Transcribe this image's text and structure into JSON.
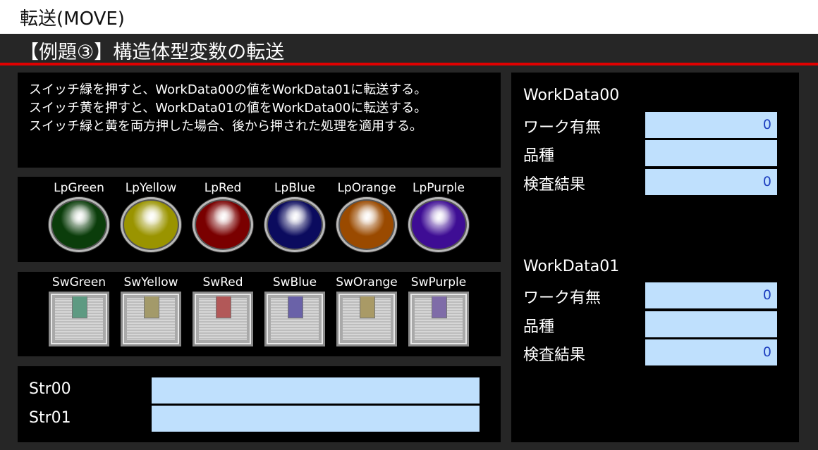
{
  "header": {
    "title": "転送(MOVE)"
  },
  "banner": {
    "title": "【例題③】構造体型変数の転送"
  },
  "description": {
    "lines": [
      "スイッチ緑を押すと、WorkData00の値をWorkData01に転送する。",
      "スイッチ黄を押すと、WorkData01の値をWorkData00に転送する。",
      "スイッチ緑と黄を両方押した場合、後から押された処理を適用する。"
    ]
  },
  "lamps": [
    {
      "label": "LpGreen",
      "color": "#0b3d0b"
    },
    {
      "label": "LpYellow",
      "color": "#9a9400"
    },
    {
      "label": "LpRed",
      "color": "#7a0000"
    },
    {
      "label": "LpBlue",
      "color": "#0b0b5e"
    },
    {
      "label": "LpOrange",
      "color": "#9a4a00"
    },
    {
      "label": "LpPurple",
      "color": "#3e0d94"
    }
  ],
  "switches": [
    {
      "label": "SwGreen",
      "color": "#5e9a82"
    },
    {
      "label": "SwYellow",
      "color": "#a39a6a"
    },
    {
      "label": "SwRed",
      "color": "#b25858"
    },
    {
      "label": "SwBlue",
      "color": "#6a62a8"
    },
    {
      "label": "SwOrange",
      "color": "#a99a66"
    },
    {
      "label": "SwPurple",
      "color": "#7f6ca8"
    }
  ],
  "strings": {
    "str00": {
      "label": "Str00",
      "value": ""
    },
    "str01": {
      "label": "Str01",
      "value": ""
    }
  },
  "workdata00": {
    "title": "WorkData00",
    "work_label": "ワーク有無",
    "work_value": "0",
    "type_label": "品種",
    "type_value": "",
    "result_label": "検査結果",
    "result_value": "0"
  },
  "workdata01": {
    "title": "WorkData01",
    "work_label": "ワーク有無",
    "work_value": "0",
    "type_label": "品種",
    "type_value": "",
    "result_label": "検査結果",
    "result_value": "0"
  }
}
